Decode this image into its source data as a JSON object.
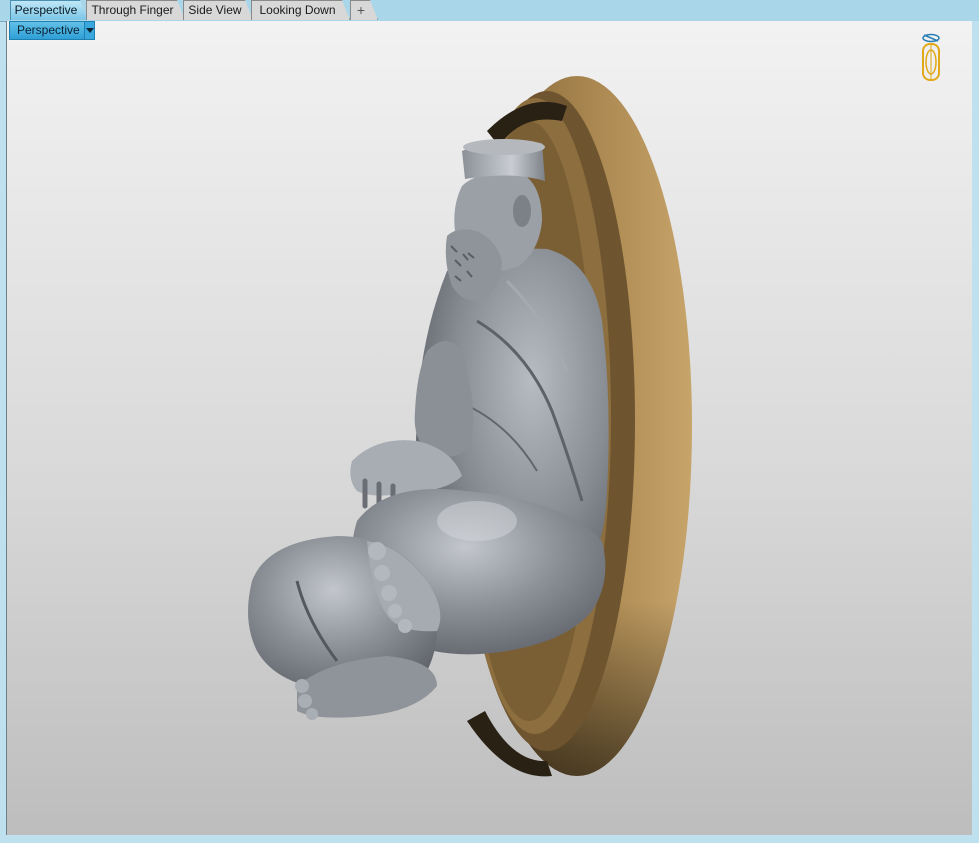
{
  "tabs": [
    {
      "label": "Perspective",
      "active": true
    },
    {
      "label": "Through Finger",
      "active": false
    },
    {
      "label": "Side View",
      "active": false
    },
    {
      "label": "Looking Down",
      "active": false
    }
  ],
  "add_tab_icon": "plus-icon",
  "viewport": {
    "name": "Perspective",
    "dropdown_icon": "triangle-down-icon",
    "gizmo_icon": "gumball-widget-icon"
  },
  "colors": {
    "active_tab": "#7cc6e6",
    "model_gray": "#8a8f96",
    "base_bronze": "#a9864f"
  }
}
